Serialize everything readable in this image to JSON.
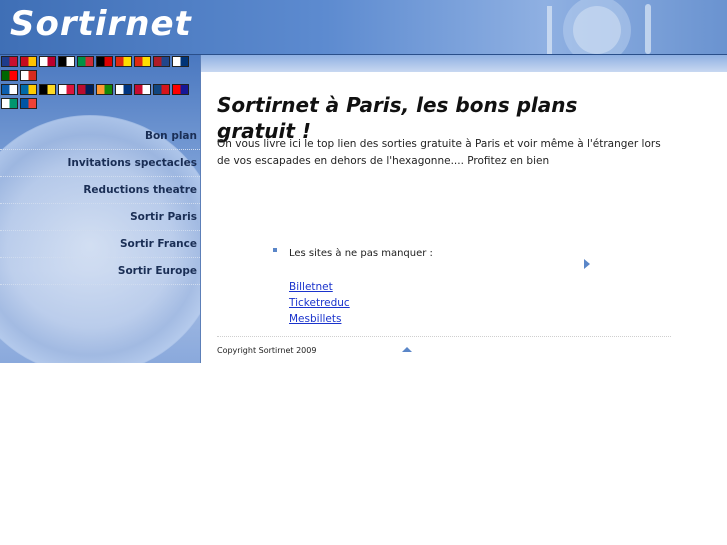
{
  "header": {
    "title": "Sortirnet"
  },
  "flags": {
    "rows": [
      [
        {
          "name": "uk-flag",
          "colors": [
            "#1e3c8c",
            "#c8102e"
          ]
        },
        {
          "name": "spain-flag",
          "colors": [
            "#c60b1e",
            "#ffc400"
          ]
        },
        {
          "name": "japan-flag",
          "colors": [
            "#ffffff",
            "#bc002d"
          ]
        },
        {
          "name": "palestine-flag",
          "colors": [
            "#000000",
            "#ffffff"
          ]
        },
        {
          "name": "italy-flag",
          "colors": [
            "#009246",
            "#ce2b37"
          ]
        },
        {
          "name": "germany-flag",
          "colors": [
            "#000000",
            "#dd0000"
          ]
        },
        {
          "name": "china-flag",
          "colors": [
            "#de2910",
            "#ffde00"
          ]
        },
        {
          "name": "china-flag-2",
          "colors": [
            "#de2910",
            "#ffde00"
          ]
        },
        {
          "name": "netherlands-flag",
          "colors": [
            "#ae1c28",
            "#21468b"
          ]
        },
        {
          "name": "korea-flag",
          "colors": [
            "#ffffff",
            "#003478"
          ]
        }
      ],
      [
        {
          "name": "portugal-flag",
          "colors": [
            "#006600",
            "#ff0000"
          ]
        },
        {
          "name": "russia-flag",
          "colors": [
            "#ffffff",
            "#d52b1e"
          ]
        }
      ],
      [
        {
          "name": "greece-flag",
          "colors": [
            "#0d5eaf",
            "#ffffff"
          ]
        },
        {
          "name": "sweden-flag",
          "colors": [
            "#006aa7",
            "#fecc00"
          ]
        },
        {
          "name": "belgium-flag",
          "colors": [
            "#000000",
            "#fdda24"
          ]
        },
        {
          "name": "poland-flag",
          "colors": [
            "#ffffff",
            "#dc143c"
          ]
        },
        {
          "name": "norway-flag",
          "colors": [
            "#ba0c2f",
            "#00205b"
          ]
        },
        {
          "name": "india-flag",
          "colors": [
            "#ff9933",
            "#138808"
          ]
        },
        {
          "name": "finland-flag",
          "colors": [
            "#ffffff",
            "#003580"
          ]
        },
        {
          "name": "denmark-flag",
          "colors": [
            "#c60c30",
            "#ffffff"
          ]
        },
        {
          "name": "czech-flag",
          "colors": [
            "#11457e",
            "#d7141a"
          ]
        },
        {
          "name": "croatia-flag",
          "colors": [
            "#ff0000",
            "#171796"
          ]
        }
      ],
      [
        {
          "name": "bulgaria-flag",
          "colors": [
            "#ffffff",
            "#00966e"
          ]
        },
        {
          "name": "france-flag",
          "colors": [
            "#0055a4",
            "#ef4135"
          ]
        }
      ]
    ]
  },
  "sidebar": {
    "menu": [
      {
        "label": "Bon plan"
      },
      {
        "label": "Invitations spectacles"
      },
      {
        "label": "Reductions theatre"
      },
      {
        "label": "Sortir Paris"
      },
      {
        "label": "Sortir France"
      },
      {
        "label": "Sortir Europe"
      }
    ]
  },
  "main": {
    "title": "Sortirnet à Paris, les bons plans gratuit !",
    "intro": "On vous livre ici le top lien des sorties gratuite à Paris et voir même à l'étranger lors de vos escapades en dehors de l'hexagonne.... Profitez en bien",
    "sites_label": "Les sites à ne pas manquer :",
    "links": [
      {
        "label": "Billetnet"
      },
      {
        "label": "Ticketreduc"
      },
      {
        "label": "Mesbillets"
      }
    ],
    "copyright": "Copyright Sortirnet 2009"
  },
  "colors": {
    "accent": "#5a86c8",
    "link": "#1a33cc",
    "header": "#3f6fb6"
  }
}
